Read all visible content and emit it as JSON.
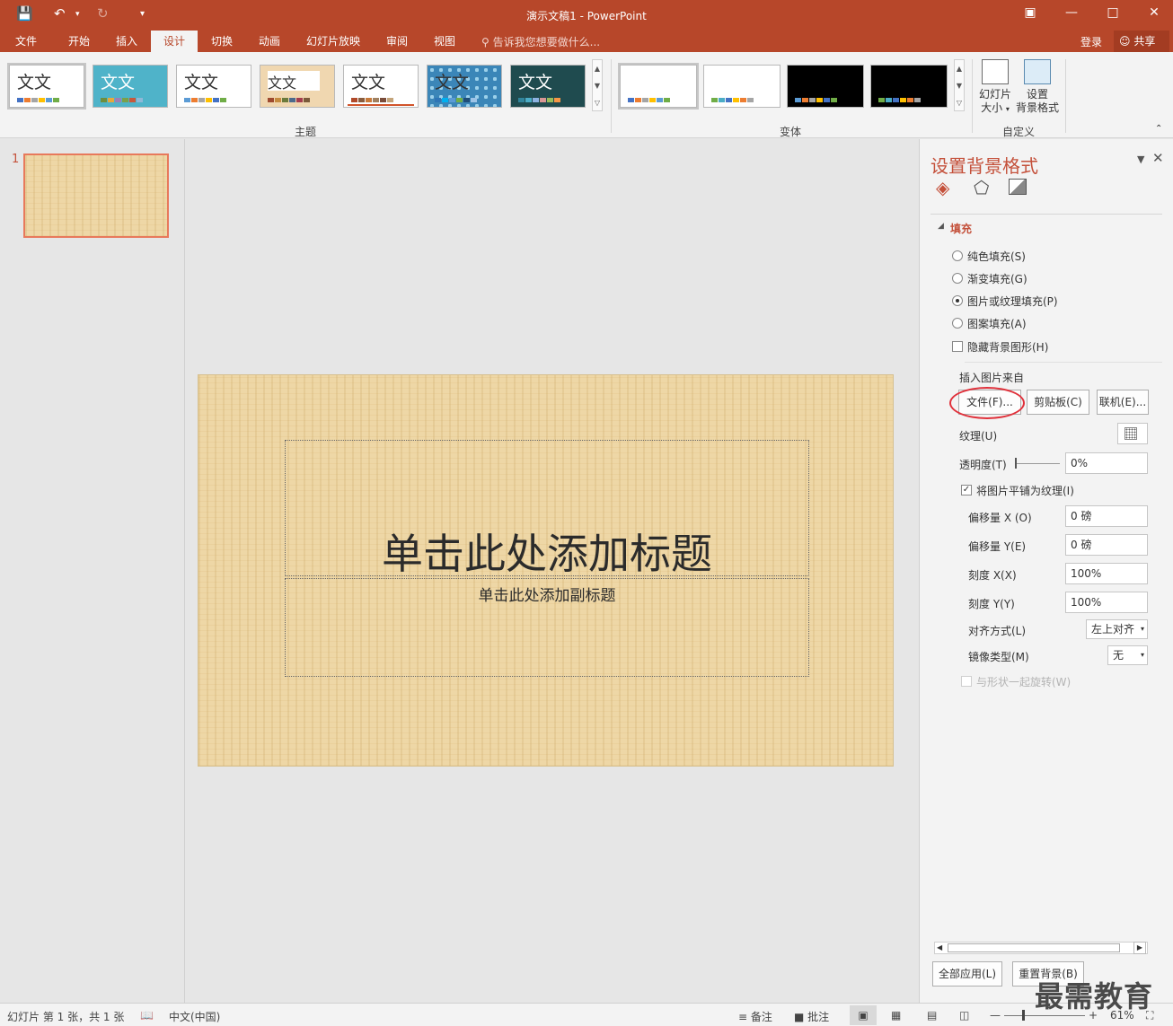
{
  "window": {
    "title": "演示文稿1 - PowerPoint"
  },
  "tabs": [
    "文件",
    "开始",
    "插入",
    "设计",
    "切换",
    "动画",
    "幻灯片放映",
    "审阅",
    "视图"
  ],
  "active_tab": "设计",
  "tell_me": "告诉我您想要做什么...",
  "account": {
    "login": "登录",
    "share": "共享"
  },
  "ribbon": {
    "themes_group": "主题",
    "variants_group": "体",
    "variants_group_full": "变体",
    "customize_group": "自定义",
    "theme_text": "文文",
    "slide_size_label_1": "幻灯片",
    "slide_size_label_2": "大小",
    "format_bg_label_1": "设置",
    "format_bg_label_2": "背景格式"
  },
  "thumbnails": {
    "slide_number": "1"
  },
  "slide": {
    "title_placeholder": "单击此处添加标题",
    "subtitle_placeholder": "单击此处添加副标题"
  },
  "format_pane": {
    "title": "设置背景格式",
    "fill_section": "填充",
    "fill_options": [
      "纯色填充(S)",
      "渐变填充(G)",
      "图片或纹理填充(P)",
      "图案填充(A)"
    ],
    "selected_fill": "图片或纹理填充(P)",
    "hide_bg_graphics": "隐藏背景图形(H)",
    "insert_from": "插入图片来自",
    "file_button": "文件(F)...",
    "clipboard_button": "剪贴板(C)",
    "online_button": "联机(E)...",
    "texture_label": "纹理(U)",
    "transparency_label": "透明度(T)",
    "transparency_value": "0%",
    "tile_label": "将图片平铺为纹理(I)",
    "offset_x_label": "偏移量 X (O)",
    "offset_x_value": "0 磅",
    "offset_y_label": "偏移量 Y(E)",
    "offset_y_value": "0 磅",
    "scale_x_label": "刻度 X(X)",
    "scale_x_value": "100%",
    "scale_y_label": "刻度 Y(Y)",
    "scale_y_value": "100%",
    "align_label": "对齐方式(L)",
    "align_value": "左上对齐",
    "mirror_label": "镜像类型(M)",
    "mirror_value": "无",
    "rotate_label": "与形状一起旋转(W)",
    "apply_all_button": "全部应用(L)",
    "reset_button": "重置背景(B)"
  },
  "status": {
    "slide_info": "幻灯片 第 1 张，共 1 张",
    "language": "中文(中国)",
    "notes": "备注",
    "comments": "批注",
    "zoom": "61%"
  },
  "watermark": "最需教育",
  "colors": {
    "accent": "#b7472a",
    "ribbon": "#f3f3f3",
    "highlight_circle": "#e0303a",
    "thumb_border": "#e8795b"
  }
}
